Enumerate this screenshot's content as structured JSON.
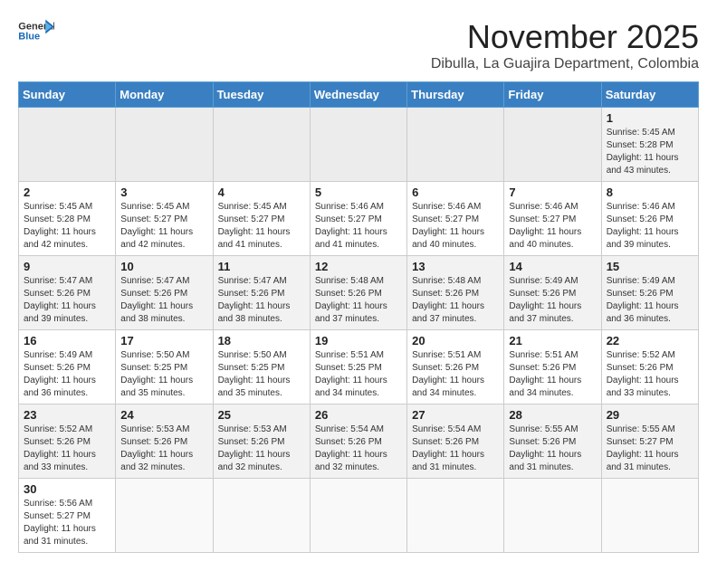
{
  "logo": {
    "line1": "General",
    "line2": "Blue"
  },
  "title": "November 2025",
  "subtitle": "Dibulla, La Guajira Department, Colombia",
  "weekdays": [
    "Sunday",
    "Monday",
    "Tuesday",
    "Wednesday",
    "Thursday",
    "Friday",
    "Saturday"
  ],
  "weeks": [
    [
      {
        "day": "",
        "info": ""
      },
      {
        "day": "",
        "info": ""
      },
      {
        "day": "",
        "info": ""
      },
      {
        "day": "",
        "info": ""
      },
      {
        "day": "",
        "info": ""
      },
      {
        "day": "",
        "info": ""
      },
      {
        "day": "1",
        "info": "Sunrise: 5:45 AM\nSunset: 5:28 PM\nDaylight: 11 hours and 43 minutes."
      }
    ],
    [
      {
        "day": "2",
        "info": "Sunrise: 5:45 AM\nSunset: 5:28 PM\nDaylight: 11 hours and 42 minutes."
      },
      {
        "day": "3",
        "info": "Sunrise: 5:45 AM\nSunset: 5:27 PM\nDaylight: 11 hours and 42 minutes."
      },
      {
        "day": "4",
        "info": "Sunrise: 5:45 AM\nSunset: 5:27 PM\nDaylight: 11 hours and 41 minutes."
      },
      {
        "day": "5",
        "info": "Sunrise: 5:46 AM\nSunset: 5:27 PM\nDaylight: 11 hours and 41 minutes."
      },
      {
        "day": "6",
        "info": "Sunrise: 5:46 AM\nSunset: 5:27 PM\nDaylight: 11 hours and 40 minutes."
      },
      {
        "day": "7",
        "info": "Sunrise: 5:46 AM\nSunset: 5:27 PM\nDaylight: 11 hours and 40 minutes."
      },
      {
        "day": "8",
        "info": "Sunrise: 5:46 AM\nSunset: 5:26 PM\nDaylight: 11 hours and 39 minutes."
      }
    ],
    [
      {
        "day": "9",
        "info": "Sunrise: 5:47 AM\nSunset: 5:26 PM\nDaylight: 11 hours and 39 minutes."
      },
      {
        "day": "10",
        "info": "Sunrise: 5:47 AM\nSunset: 5:26 PM\nDaylight: 11 hours and 38 minutes."
      },
      {
        "day": "11",
        "info": "Sunrise: 5:47 AM\nSunset: 5:26 PM\nDaylight: 11 hours and 38 minutes."
      },
      {
        "day": "12",
        "info": "Sunrise: 5:48 AM\nSunset: 5:26 PM\nDaylight: 11 hours and 37 minutes."
      },
      {
        "day": "13",
        "info": "Sunrise: 5:48 AM\nSunset: 5:26 PM\nDaylight: 11 hours and 37 minutes."
      },
      {
        "day": "14",
        "info": "Sunrise: 5:49 AM\nSunset: 5:26 PM\nDaylight: 11 hours and 37 minutes."
      },
      {
        "day": "15",
        "info": "Sunrise: 5:49 AM\nSunset: 5:26 PM\nDaylight: 11 hours and 36 minutes."
      }
    ],
    [
      {
        "day": "16",
        "info": "Sunrise: 5:49 AM\nSunset: 5:26 PM\nDaylight: 11 hours and 36 minutes."
      },
      {
        "day": "17",
        "info": "Sunrise: 5:50 AM\nSunset: 5:25 PM\nDaylight: 11 hours and 35 minutes."
      },
      {
        "day": "18",
        "info": "Sunrise: 5:50 AM\nSunset: 5:25 PM\nDaylight: 11 hours and 35 minutes."
      },
      {
        "day": "19",
        "info": "Sunrise: 5:51 AM\nSunset: 5:25 PM\nDaylight: 11 hours and 34 minutes."
      },
      {
        "day": "20",
        "info": "Sunrise: 5:51 AM\nSunset: 5:26 PM\nDaylight: 11 hours and 34 minutes."
      },
      {
        "day": "21",
        "info": "Sunrise: 5:51 AM\nSunset: 5:26 PM\nDaylight: 11 hours and 34 minutes."
      },
      {
        "day": "22",
        "info": "Sunrise: 5:52 AM\nSunset: 5:26 PM\nDaylight: 11 hours and 33 minutes."
      }
    ],
    [
      {
        "day": "23",
        "info": "Sunrise: 5:52 AM\nSunset: 5:26 PM\nDaylight: 11 hours and 33 minutes."
      },
      {
        "day": "24",
        "info": "Sunrise: 5:53 AM\nSunset: 5:26 PM\nDaylight: 11 hours and 32 minutes."
      },
      {
        "day": "25",
        "info": "Sunrise: 5:53 AM\nSunset: 5:26 PM\nDaylight: 11 hours and 32 minutes."
      },
      {
        "day": "26",
        "info": "Sunrise: 5:54 AM\nSunset: 5:26 PM\nDaylight: 11 hours and 32 minutes."
      },
      {
        "day": "27",
        "info": "Sunrise: 5:54 AM\nSunset: 5:26 PM\nDaylight: 11 hours and 31 minutes."
      },
      {
        "day": "28",
        "info": "Sunrise: 5:55 AM\nSunset: 5:26 PM\nDaylight: 11 hours and 31 minutes."
      },
      {
        "day": "29",
        "info": "Sunrise: 5:55 AM\nSunset: 5:27 PM\nDaylight: 11 hours and 31 minutes."
      }
    ],
    [
      {
        "day": "30",
        "info": "Sunrise: 5:56 AM\nSunset: 5:27 PM\nDaylight: 11 hours and 31 minutes."
      },
      {
        "day": "",
        "info": ""
      },
      {
        "day": "",
        "info": ""
      },
      {
        "day": "",
        "info": ""
      },
      {
        "day": "",
        "info": ""
      },
      {
        "day": "",
        "info": ""
      },
      {
        "day": "",
        "info": ""
      }
    ]
  ]
}
